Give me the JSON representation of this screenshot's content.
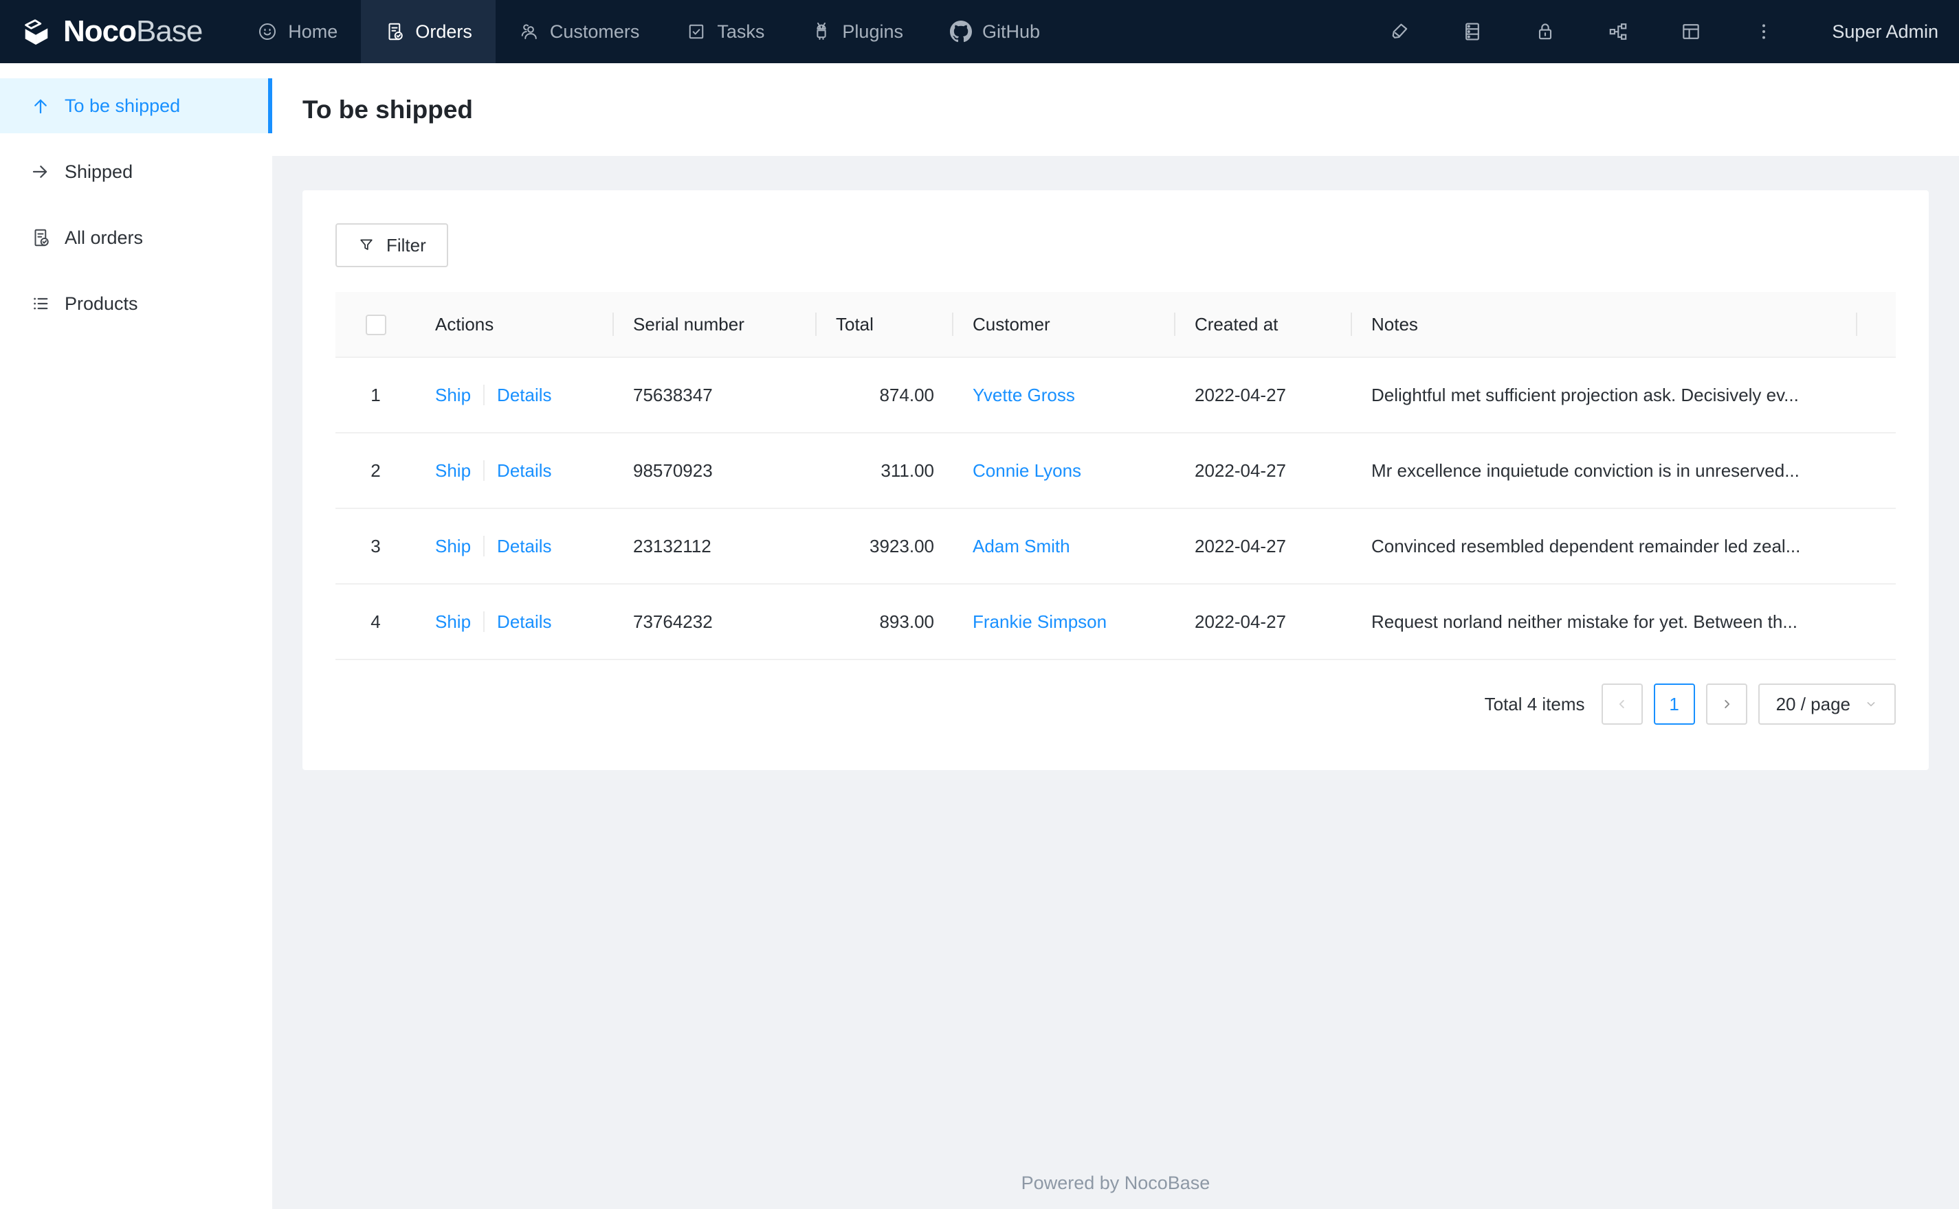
{
  "navbar": {
    "logo": {
      "text_bold": "Noco",
      "text_light": "Base",
      "mark_icon": "nocobase-logo-mark"
    },
    "items": [
      {
        "label": "Home",
        "icon": "smile-icon",
        "active": false
      },
      {
        "label": "Orders",
        "icon": "file-done-icon",
        "active": true
      },
      {
        "label": "Customers",
        "icon": "team-icon",
        "active": false
      },
      {
        "label": "Tasks",
        "icon": "check-square-icon",
        "active": false
      },
      {
        "label": "Plugins",
        "icon": "android-icon",
        "active": false
      },
      {
        "label": "GitHub",
        "icon": "github-icon",
        "active": false
      }
    ],
    "right_icons": [
      "highlighter-icon",
      "database-icon",
      "lock-icon",
      "cluster-icon",
      "layout-icon",
      "kebab-menu-icon"
    ],
    "user": "Super Admin"
  },
  "sidebar": {
    "items": [
      {
        "label": "To be shipped",
        "icon": "arrow-up-icon",
        "active": true
      },
      {
        "label": "Shipped",
        "icon": "arrow-right-icon",
        "active": false
      },
      {
        "label": "All orders",
        "icon": "file-done-icon",
        "active": false
      },
      {
        "label": "Products",
        "icon": "unordered-list-icon",
        "active": false
      }
    ]
  },
  "page": {
    "title": "To be shipped"
  },
  "toolbar": {
    "filter_label": "Filter",
    "filter_icon": "funnel-icon"
  },
  "table": {
    "columns": [
      "",
      "Actions",
      "Serial number",
      "Total",
      "Customer",
      "Created at",
      "Notes"
    ],
    "rows": [
      {
        "index": "1",
        "actions": [
          "Ship",
          "Details"
        ],
        "serial_number": "75638347",
        "total": "874.00",
        "customer": "Yvette Gross",
        "created_at": "2022-04-27",
        "notes": "Delightful met sufficient projection ask. Decisively ev..."
      },
      {
        "index": "2",
        "actions": [
          "Ship",
          "Details"
        ],
        "serial_number": "98570923",
        "total": "311.00",
        "customer": "Connie Lyons",
        "created_at": "2022-04-27",
        "notes": "Mr excellence inquietude conviction is in unreserved..."
      },
      {
        "index": "3",
        "actions": [
          "Ship",
          "Details"
        ],
        "serial_number": "23132112",
        "total": "3923.00",
        "customer": "Adam Smith",
        "created_at": "2022-04-27",
        "notes": "Convinced resembled dependent remainder led zeal..."
      },
      {
        "index": "4",
        "actions": [
          "Ship",
          "Details"
        ],
        "serial_number": "73764232",
        "total": "893.00",
        "customer": "Frankie Simpson",
        "created_at": "2022-04-27",
        "notes": "Request norland neither mistake for yet. Between th..."
      }
    ]
  },
  "pagination": {
    "total_text": "Total 4 items",
    "current_page": "1",
    "page_size_label": "20 / page"
  },
  "footer": {
    "text": "Powered by NocoBase"
  },
  "colors": {
    "navbar_bg": "#0b1b2e",
    "navbar_active_bg": "#1b2c42",
    "primary": "#1890ff",
    "sidebar_active_bg": "#e6f7ff",
    "content_bg": "#f0f2f5",
    "table_header_bg": "#fafafa",
    "row_border": "#f0f0f0"
  }
}
